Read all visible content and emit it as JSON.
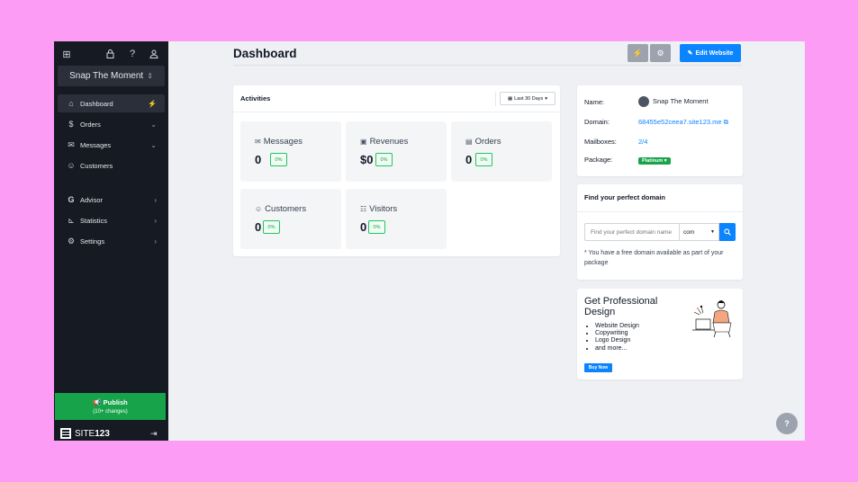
{
  "sidebar": {
    "site_name": "Snap The Moment",
    "items": [
      {
        "label": "Dashboard"
      },
      {
        "label": "Orders"
      },
      {
        "label": "Messages"
      },
      {
        "label": "Customers"
      },
      {
        "label": "Advisor"
      },
      {
        "label": "Statistics"
      },
      {
        "label": "Settings"
      }
    ],
    "publish_label": "Publish",
    "publish_sub": "(10+ changes)",
    "logo_prefix": "SITE",
    "logo_suffix": "123"
  },
  "header": {
    "title": "Dashboard",
    "edit_label": "Edit Website"
  },
  "activities": {
    "title": "Activities",
    "range": "Last 30 Days",
    "stats": [
      {
        "label": "Messages",
        "value": "0",
        "pct": "0%"
      },
      {
        "label": "Revenues",
        "value": "$0",
        "pct": "0%"
      },
      {
        "label": "Orders",
        "value": "0",
        "pct": "0%"
      },
      {
        "label": "Customers",
        "value": "0",
        "pct": "0%"
      },
      {
        "label": "Visitors",
        "value": "0",
        "pct": "0%"
      }
    ]
  },
  "site_info": {
    "name_label": "Name:",
    "name_value": "Snap The Moment",
    "domain_label": "Domain:",
    "domain_value": "68455e52ceea7.site123.me",
    "mailboxes_label": "Mailboxes:",
    "mailboxes_value": "2/4",
    "package_label": "Package:",
    "package_value": "Platinum"
  },
  "domain_search": {
    "title": "Find your perfect domain",
    "placeholder": "Find your perfect domain name",
    "tld": "com",
    "note": "* You have a free domain available as part of your package"
  },
  "promo": {
    "title": "Get Professional Design",
    "items": [
      "Website Design",
      "Copywriting",
      "Logo Design",
      "and more..."
    ],
    "buy_label": "Buy Now"
  },
  "help_label": "?",
  "colors": {
    "background": "#fc9cf5",
    "sidebar": "#161a22",
    "accent": "#0b84ff",
    "success": "#16a34a"
  }
}
